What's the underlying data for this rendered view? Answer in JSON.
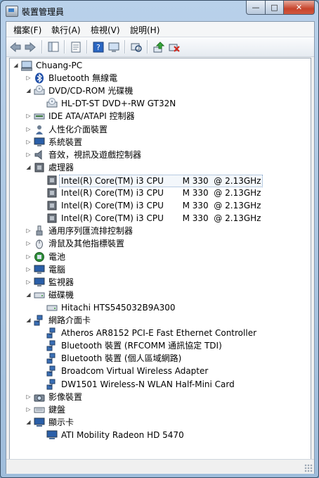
{
  "window": {
    "title": "裝置管理員",
    "controls": {
      "minimize": "—",
      "maximize": "□",
      "close": "✕"
    }
  },
  "menu": [
    "檔案(F)",
    "執行(A)",
    "檢視(V)",
    "說明(H)"
  ],
  "toolbar": [
    "back-arrow-icon",
    "forward-arrow-icon",
    "tree-view-icon",
    "properties-icon",
    "help-icon",
    "computer-view-icon",
    "scan-hardware-icon",
    "update-driver-icon",
    "uninstall-icon"
  ],
  "tree": [
    {
      "level": 0,
      "exp": "◢",
      "icon": "computer",
      "text": "Chuang-PC"
    },
    {
      "level": 1,
      "exp": "▷",
      "icon": "bluetooth",
      "text": "Bluetooth 無線電"
    },
    {
      "level": 1,
      "exp": "◢",
      "icon": "dvd",
      "text": "DVD/CD-ROM 光碟機"
    },
    {
      "level": 2,
      "exp": "",
      "icon": "dvd",
      "text": "HL-DT-ST DVD+-RW GT32N"
    },
    {
      "level": 1,
      "exp": "▷",
      "icon": "ide",
      "text": "IDE ATA/ATAPI 控制器"
    },
    {
      "level": 1,
      "exp": "▷",
      "icon": "person",
      "text": "人性化介面裝置"
    },
    {
      "level": 1,
      "exp": "▷",
      "icon": "monitor",
      "text": "系統裝置"
    },
    {
      "level": 1,
      "exp": "▷",
      "icon": "speaker",
      "text": "音效，視訊及遊戲控制器"
    },
    {
      "level": 1,
      "exp": "◢",
      "icon": "cpu",
      "text": "處理器"
    },
    {
      "level": 2,
      "exp": "",
      "icon": "cpu",
      "text": "Intel(R) Core(TM) i3 CPU       M 330  @ 2.13GHz",
      "selected": true
    },
    {
      "level": 2,
      "exp": "",
      "icon": "cpu",
      "text": "Intel(R) Core(TM) i3 CPU       M 330  @ 2.13GHz"
    },
    {
      "level": 2,
      "exp": "",
      "icon": "cpu",
      "text": "Intel(R) Core(TM) i3 CPU       M 330  @ 2.13GHz"
    },
    {
      "level": 2,
      "exp": "",
      "icon": "cpu",
      "text": "Intel(R) Core(TM) i3 CPU       M 330  @ 2.13GHz"
    },
    {
      "level": 1,
      "exp": "▷",
      "icon": "usb",
      "text": "通用序列匯流排控制器"
    },
    {
      "level": 1,
      "exp": "▷",
      "icon": "mouse",
      "text": "滑鼠及其他指標裝置"
    },
    {
      "level": 1,
      "exp": "▷",
      "icon": "battery",
      "text": "電池"
    },
    {
      "level": 1,
      "exp": "▷",
      "icon": "monitor",
      "text": "電腦"
    },
    {
      "level": 1,
      "exp": "▷",
      "icon": "monitor",
      "text": "監視器"
    },
    {
      "level": 1,
      "exp": "◢",
      "icon": "disk",
      "text": "磁碟機"
    },
    {
      "level": 2,
      "exp": "",
      "icon": "disk",
      "text": "Hitachi HTS545032B9A300"
    },
    {
      "level": 1,
      "exp": "◢",
      "icon": "network",
      "text": "網路介面卡"
    },
    {
      "level": 2,
      "exp": "",
      "icon": "network",
      "text": "Atheros AR8152 PCI-E Fast Ethernet Controller"
    },
    {
      "level": 2,
      "exp": "",
      "icon": "network",
      "text": "Bluetooth 裝置 (RFCOMM 通訊協定 TDI)"
    },
    {
      "level": 2,
      "exp": "",
      "icon": "network",
      "text": "Bluetooth 裝置 (個人區域網路)"
    },
    {
      "level": 2,
      "exp": "",
      "icon": "network",
      "text": "Broadcom Virtual Wireless Adapter"
    },
    {
      "level": 2,
      "exp": "",
      "icon": "network",
      "text": "DW1501 Wireless-N WLAN Half-Mini Card"
    },
    {
      "level": 1,
      "exp": "▷",
      "icon": "camera",
      "text": "影像裝置"
    },
    {
      "level": 1,
      "exp": "▷",
      "icon": "keyboard",
      "text": "鍵盤"
    },
    {
      "level": 1,
      "exp": "◢",
      "icon": "display",
      "text": "顯示卡"
    },
    {
      "level": 2,
      "exp": "",
      "icon": "display",
      "text": "ATI Mobility Radeon HD 5470"
    }
  ]
}
